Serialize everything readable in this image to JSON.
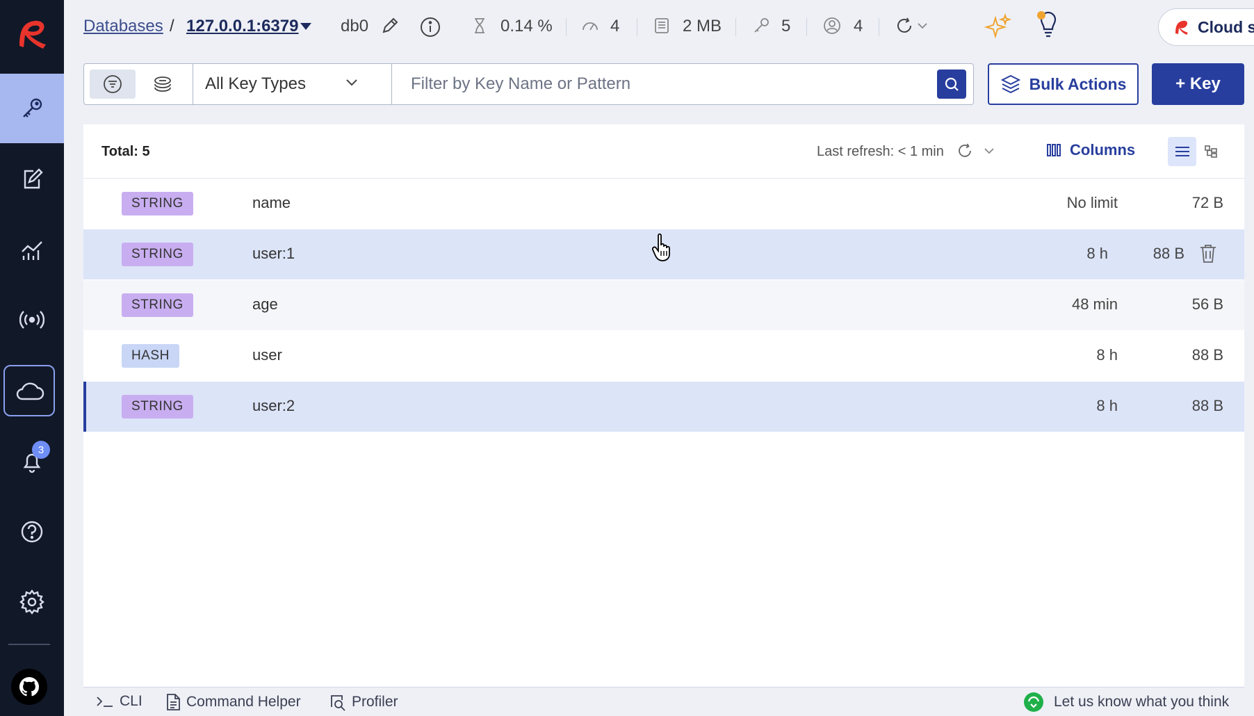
{
  "breadcrumb": {
    "databases_label": "Databases",
    "separator": "/",
    "host": "127.0.0.1:6379",
    "db": "db0"
  },
  "stats": {
    "cpu": "0.14 %",
    "ops": "4",
    "memory": "2 MB",
    "keys": "5",
    "clients": "4"
  },
  "cloud_sign_in_label": "Cloud sign in",
  "filter": {
    "key_type_selected": "All Key Types",
    "placeholder": "Filter by Key Name or Pattern"
  },
  "bulk_actions_label": "Bulk Actions",
  "add_key_label": "+ Key",
  "list": {
    "total": "Total: 5",
    "last_refresh": "Last refresh: < 1 min",
    "columns_label": "Columns",
    "rows": [
      {
        "type": "STRING",
        "name": "name",
        "ttl": "No limit",
        "size": "72 B"
      },
      {
        "type": "STRING",
        "name": "user:1",
        "ttl": "8 h",
        "size": "88 B"
      },
      {
        "type": "STRING",
        "name": "age",
        "ttl": "48 min",
        "size": "56 B"
      },
      {
        "type": "HASH",
        "name": "user",
        "ttl": "8 h",
        "size": "88 B"
      },
      {
        "type": "STRING",
        "name": "user:2",
        "ttl": "8 h",
        "size": "88 B"
      }
    ]
  },
  "notifications_count": "3",
  "bottom": {
    "cli_label": "CLI",
    "command_helper_label": "Command Helper",
    "profiler_label": "Profiler",
    "feedback_label": "Let us know what you think"
  },
  "colors": {
    "sidebar_bg": "#111828",
    "primary": "#283e9e",
    "string_badge": "#c8aef0",
    "hash_badge": "#c9d6f6",
    "active_nav": "#a7b8f0",
    "brand_red": "#e8342c"
  },
  "icons": {
    "sidebar": [
      "browser-key-icon",
      "workbench-edit-icon",
      "analytics-icon",
      "pubsub-icon",
      "cloud-icon",
      "notifications-bell-icon",
      "help-icon",
      "settings-gear-icon",
      "github-icon"
    ]
  }
}
